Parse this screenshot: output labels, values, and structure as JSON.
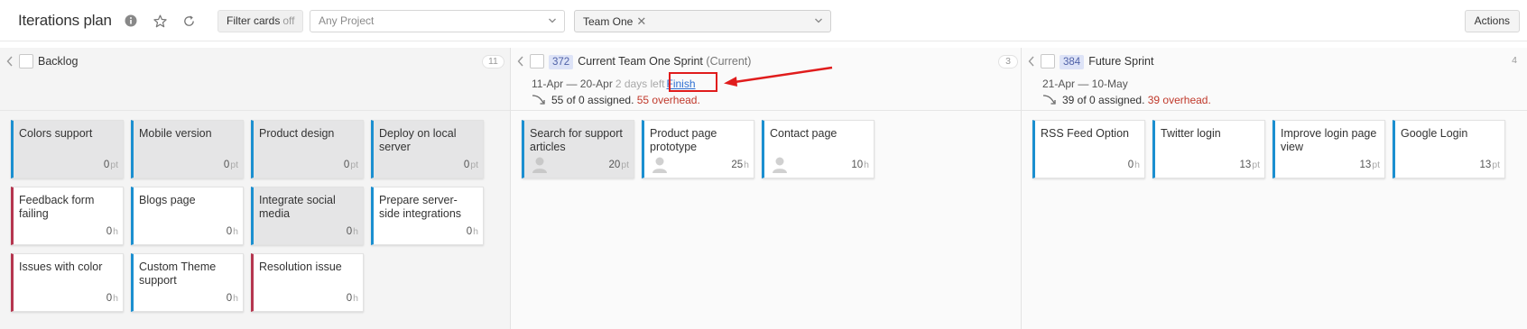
{
  "page": {
    "title": "Iterations plan",
    "filter_label": "Filter cards",
    "filter_state": "off",
    "project_placeholder": "Any Project",
    "team_tag": "Team One",
    "actions_label": "Actions"
  },
  "columns": {
    "backlog": {
      "name": "Backlog",
      "count": "11",
      "cards": [
        {
          "title": "Colors support",
          "value": "0",
          "unit": "pt"
        },
        {
          "title": "Mobile version",
          "value": "0",
          "unit": "pt"
        },
        {
          "title": "Product design",
          "value": "0",
          "unit": "pt"
        },
        {
          "title": "Deploy on local server",
          "value": "0",
          "unit": "pt"
        },
        {
          "title": "Feedback form failing",
          "value": "0",
          "unit": "h"
        },
        {
          "title": "Blogs page",
          "value": "0",
          "unit": "h"
        },
        {
          "title": "Integrate social media",
          "value": "0",
          "unit": "h"
        },
        {
          "title": "Prepare server-side integrations",
          "value": "0",
          "unit": "h"
        },
        {
          "title": "Issues with color",
          "value": "0",
          "unit": "h"
        },
        {
          "title": "Custom Theme support",
          "value": "0",
          "unit": "h"
        },
        {
          "title": "Resolution issue",
          "value": "0",
          "unit": "h"
        }
      ]
    },
    "current": {
      "id": "372",
      "name": "Current Team One Sprint",
      "state": "(Current)",
      "count": "3",
      "dates": "11-Apr — 20-Apr",
      "days_left": "2 days left",
      "finish_label": "Finish",
      "assigned": "55 of 0 assigned.",
      "overhead": "55 overhead.",
      "cards": [
        {
          "title": "Search for support articles",
          "value": "20",
          "unit": "pt"
        },
        {
          "title": "Product page prototype",
          "value": "25",
          "unit": "h"
        },
        {
          "title": "Contact page",
          "value": "10",
          "unit": "h"
        }
      ]
    },
    "future": {
      "id": "384",
      "name": "Future Sprint",
      "count": "4",
      "dates": "21-Apr — 10-May",
      "assigned": "39 of 0 assigned.",
      "overhead": "39 overhead.",
      "cards": [
        {
          "title": "RSS Feed Option",
          "value": "0",
          "unit": "h"
        },
        {
          "title": "Twitter login",
          "value": "13",
          "unit": "pt"
        },
        {
          "title": "Improve login page view",
          "value": "13",
          "unit": "pt"
        },
        {
          "title": "Google Login",
          "value": "13",
          "unit": "pt"
        }
      ]
    }
  },
  "colors": {
    "card_blue": "#1b8fd0",
    "card_red": "#b5364f",
    "overhead_red": "#c0392b",
    "annotation_red": "#e01c1c",
    "link_blue": "#2e6fd2"
  }
}
